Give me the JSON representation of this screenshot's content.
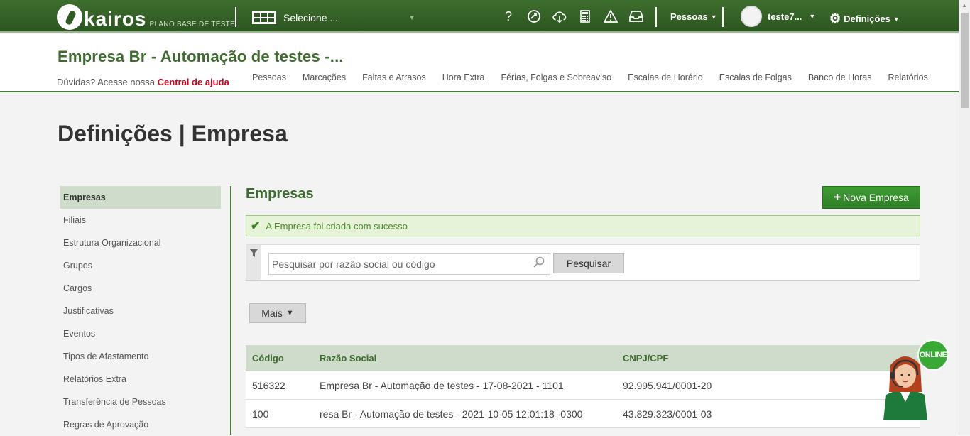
{
  "topbar": {
    "logo_text": "kairos",
    "logo_sub": "PLANO BASE DE TESTE",
    "company_select": "Selecione ...",
    "icons": [
      "help-icon",
      "tutorial-icon",
      "cloud-download-icon",
      "calculator-icon",
      "warning-icon",
      "inbox-icon"
    ],
    "help_glyph": "?",
    "pessoas_label": "Pessoas",
    "user_label": "teste7...",
    "settings_label": "Definições"
  },
  "header": {
    "company_name": "Empresa Br - Automação de testes -...",
    "help_text": "Dúvidas? Acesse nossa",
    "help_link": "Central de ajuda",
    "nav": [
      "Pessoas",
      "Marcações",
      "Faltas e Atrasos",
      "Hora Extra",
      "Férias, Folgas e Sobreaviso",
      "Escalas de Horário",
      "Escalas de Folgas",
      "Banco de Horas",
      "Relatórios"
    ]
  },
  "page": {
    "title": "Definições | Empresa"
  },
  "sidebar": {
    "items": [
      "Empresas",
      "Filiais",
      "Estrutura Organizacional",
      "Grupos",
      "Cargos",
      "Justificativas",
      "Eventos",
      "Tipos de Afastamento",
      "Relatórios Extra",
      "Transferência de Pessoas",
      "Regras de Aprovação"
    ],
    "active": "Empresas"
  },
  "main": {
    "section_title": "Empresas",
    "new_button": "Nova Empresa",
    "alert": "A Empresa foi criada com sucesso",
    "search_placeholder": "Pesquisar por razão social ou código",
    "search_button": "Pesquisar",
    "more_button": "Mais"
  },
  "table": {
    "headers": [
      "Código",
      "Razão Social",
      "CNPJ/CPF"
    ],
    "rows": [
      [
        "516322",
        "Empresa Br - Automação de testes - 17-08-2021 - 1101",
        "92.995.941/0001-20"
      ],
      [
        "100",
        "resa Br - Automação de testes - 2021-10-05 12:01:18 -0300",
        "43.829.323/0001-03"
      ]
    ]
  },
  "chat": {
    "online_label": "ONLINE"
  },
  "colors": {
    "brand_green": "#3e6b2f",
    "topbar_green": "#2c5621",
    "button_green": "#3f9b34",
    "alert_bg": "#e6f3d8",
    "help_link_red": "#d0021b"
  }
}
